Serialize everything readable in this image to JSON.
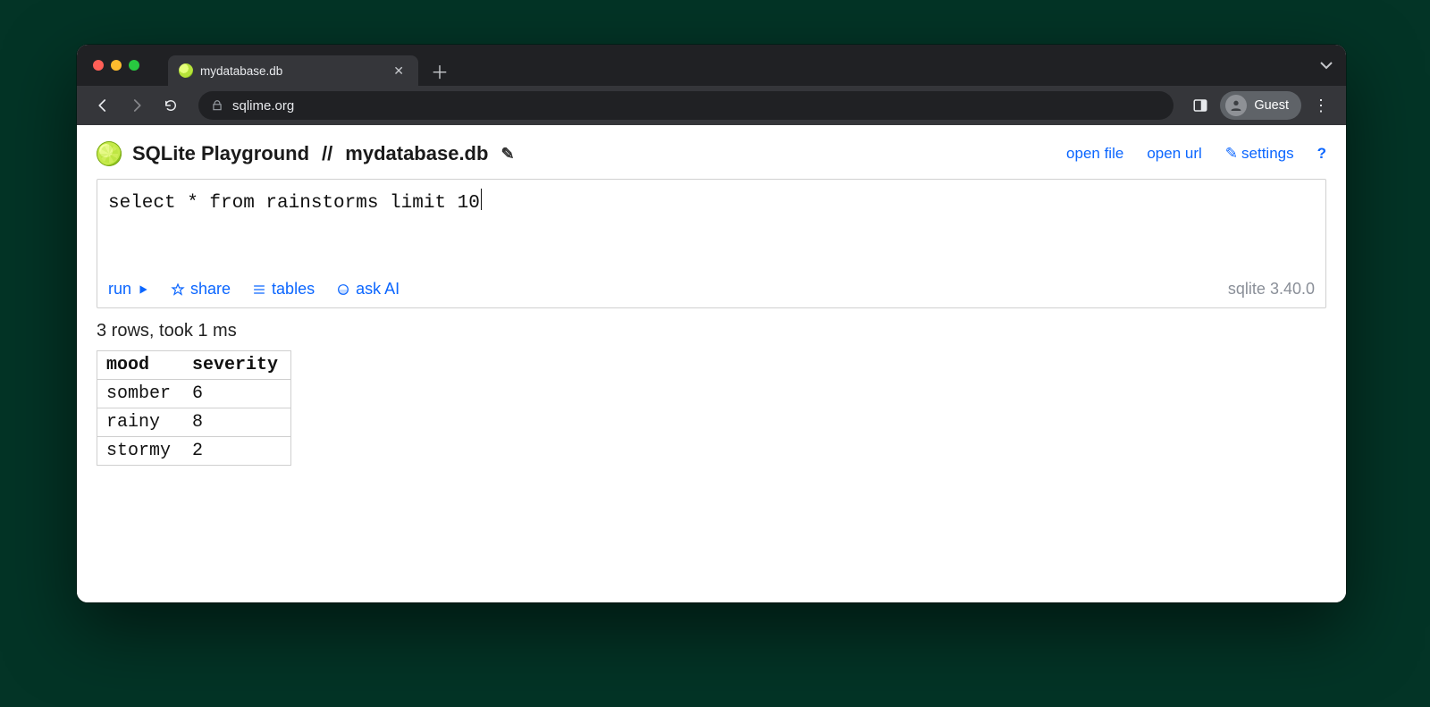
{
  "browser": {
    "tab_title": "mydatabase.db",
    "url": "sqlime.org",
    "guest_label": "Guest"
  },
  "header": {
    "app_title": "SQLite Playground",
    "db_name": "mydatabase.db",
    "links": {
      "open_file": "open file",
      "open_url": "open url",
      "settings": "settings",
      "help": "?"
    }
  },
  "editor": {
    "sql": "select * from rainstorms limit 10"
  },
  "toolbar": {
    "run": "run",
    "share": "share",
    "tables": "tables",
    "ask_ai": "ask AI",
    "sqlite_version": "sqlite 3.40.0"
  },
  "result": {
    "status": "3 rows, took 1 ms",
    "columns": [
      "mood",
      "severity"
    ],
    "rows": [
      [
        "somber",
        "6"
      ],
      [
        "rainy",
        "8"
      ],
      [
        "stormy",
        "2"
      ]
    ]
  }
}
